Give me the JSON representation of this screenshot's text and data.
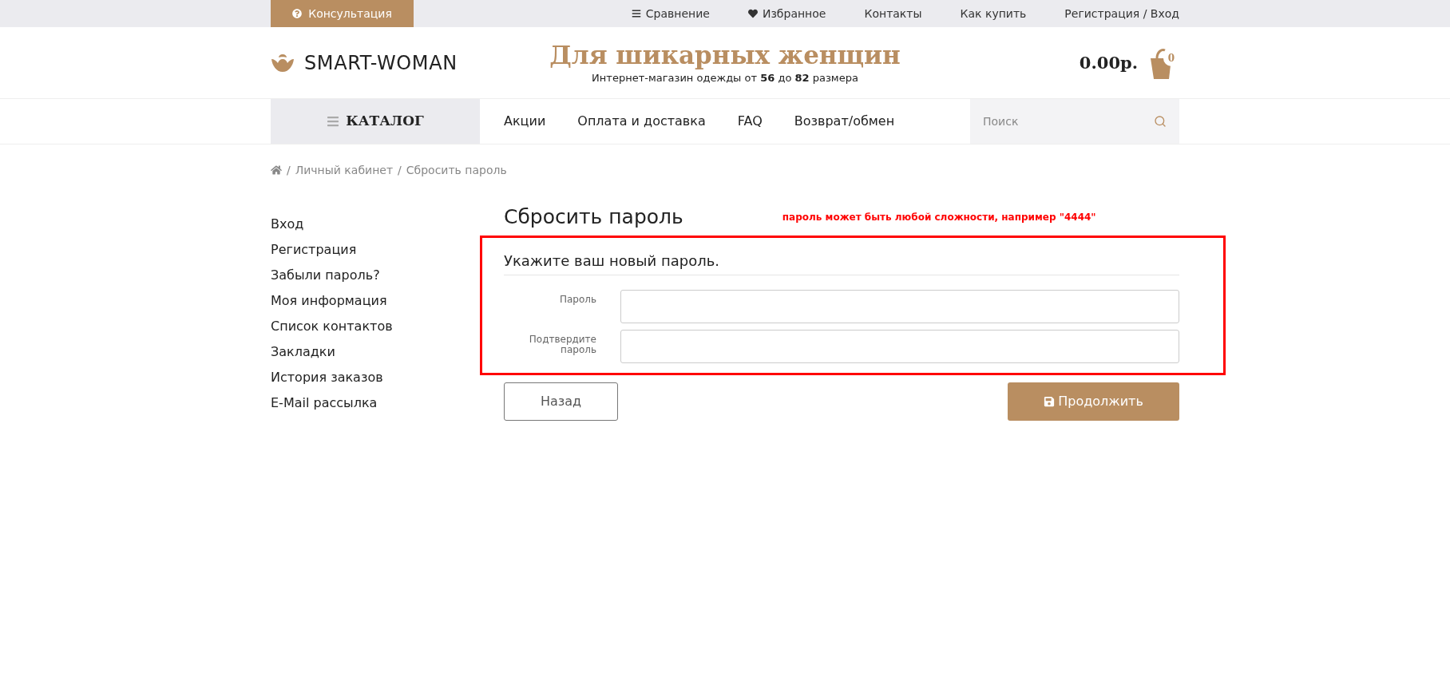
{
  "top_bar": {
    "consult_button": "Консультация",
    "links": [
      "Сравнение",
      "Избранное",
      "Контакты",
      "Как купить",
      "Регистрация / Вход"
    ]
  },
  "header": {
    "logo": "SMART-WOMAN",
    "slogan": "Для шикарных женщин",
    "tagline": "Интернет-магазин одежды от **56** до **82** размера",
    "cart_total": "0.00р.",
    "cart_count": "0"
  },
  "nav": {
    "catalog": "КАТАЛОГ",
    "items": [
      "Акции",
      "Оплата и доставка",
      "FAQ",
      "Возврат/обмен"
    ],
    "search": {
      "placeholder": "Поиск"
    }
  },
  "breadcrumb": [
    {
      "separator": "/",
      "label": "Личный кабинет"
    },
    {
      "separator": "/",
      "label": "Сбросить пароль"
    }
  ],
  "sidebar": {
    "items": [
      "Вход",
      "Регистрация",
      "Забыли пароль?",
      "Моя информация",
      "Список контактов",
      "Закладки",
      "История заказов",
      "E-Mail рассылка"
    ]
  },
  "page": {
    "title": "Сбросить пароль",
    "annotation": "пароль может быть любой сложности, например \"4444\"",
    "subtitle": "Укажите ваш новый пароль.",
    "fields": [
      {
        "label": "Пароль"
      },
      {
        "label": "Подтвердите пароль"
      }
    ],
    "back_button": "Назад",
    "continue_button": "Продолжить"
  }
}
